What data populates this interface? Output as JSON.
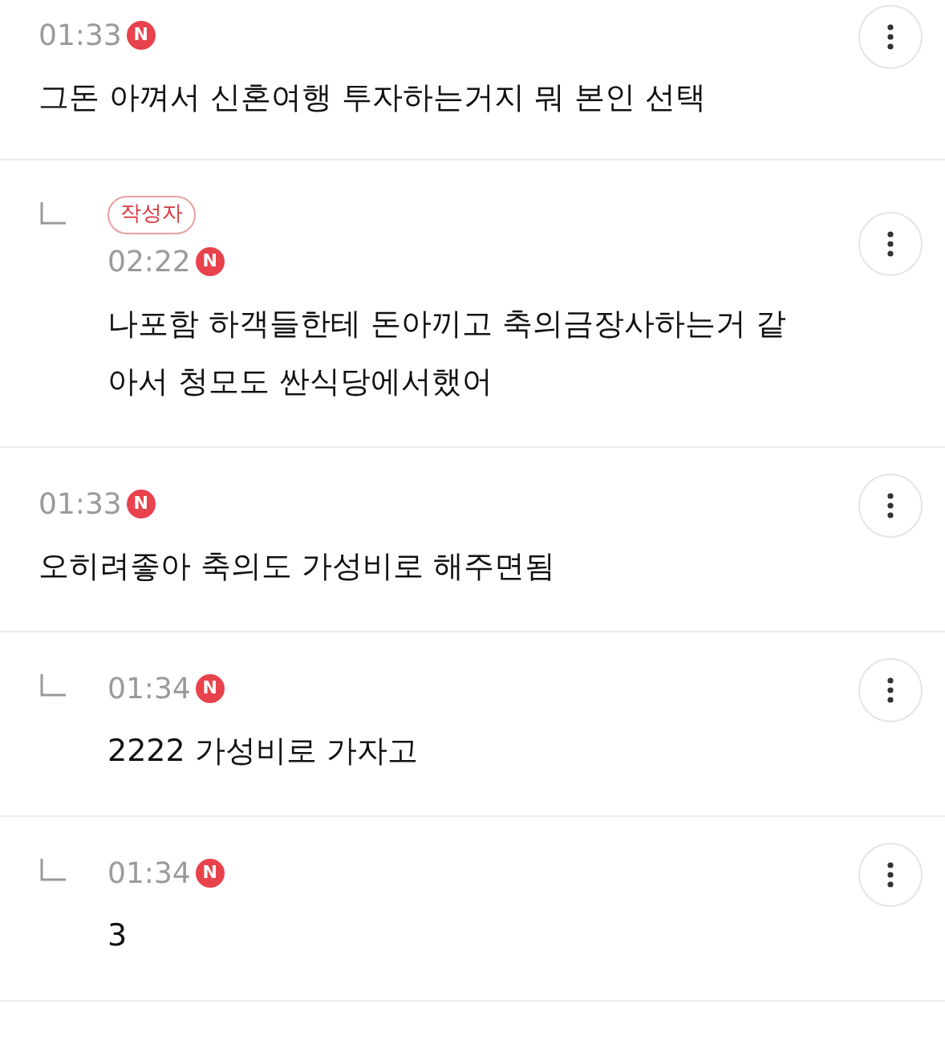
{
  "comments": [
    {
      "kind": "comment",
      "time": "01:33",
      "new_badge": "N",
      "text": "그돈 아껴서 신혼여행 투자하는거지 뭐 본인 선택"
    },
    {
      "kind": "reply",
      "author_badge": "작성자",
      "time": "02:22",
      "new_badge": "N",
      "text": "나포함 하객들한테 돈아끼고 축의금장사하는거 같아서 청모도 싼식당에서했어"
    },
    {
      "kind": "comment",
      "time": "01:33",
      "new_badge": "N",
      "text": "오히려좋아 축의도 가성비로 해주면됨"
    },
    {
      "kind": "reply",
      "time": "01:34",
      "new_badge": "N",
      "text": "2222 가성비로 가자고"
    },
    {
      "kind": "reply",
      "time": "01:34",
      "new_badge": "N",
      "text": "3"
    }
  ]
}
